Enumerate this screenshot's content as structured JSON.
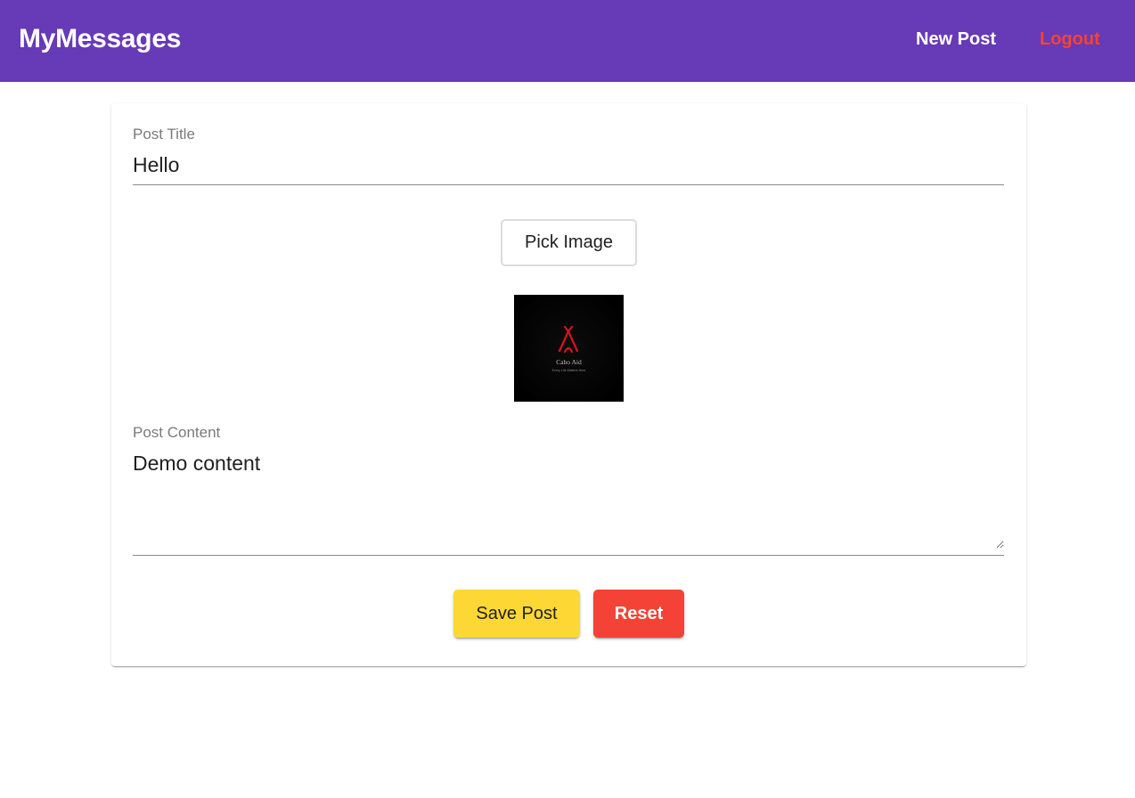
{
  "header": {
    "app_title": "MyMessages",
    "nav": {
      "new_post": "New Post",
      "logout": "Logout"
    },
    "colors": {
      "background": "#673ab7",
      "logout": "#f44336"
    }
  },
  "form": {
    "title": {
      "label": "Post Title",
      "value": "Hello"
    },
    "pick_image_label": "Pick Image",
    "image_preview": {
      "logo_text": "Cabo Aid",
      "tagline": "Every Life Matters Here"
    },
    "content": {
      "label": "Post Content",
      "value": "Demo content"
    },
    "actions": {
      "save_label": "Save Post",
      "reset_label": "Reset"
    },
    "colors": {
      "save": "#fdd835",
      "reset": "#f44336"
    }
  }
}
